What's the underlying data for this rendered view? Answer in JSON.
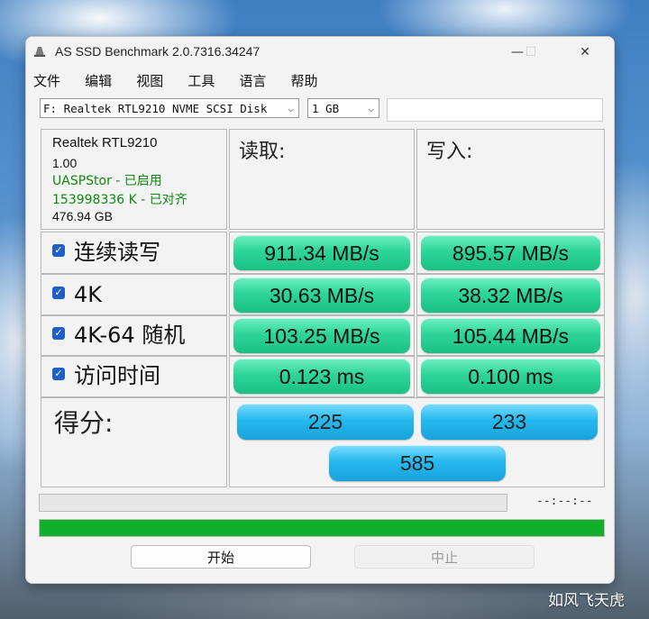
{
  "window": {
    "title": "AS SSD Benchmark 2.0.7316.34247"
  },
  "menu": [
    "文件",
    "编辑",
    "视图",
    "工具",
    "语言",
    "帮助"
  ],
  "toolbar": {
    "drive": "F: Realtek RTL9210 NVME SCSI Disk",
    "size": "1 GB",
    "extra_field": ""
  },
  "device_info": {
    "name": "Realtek RTL9210",
    "firmware": "1.00",
    "driver": "UASPStor - 已启用",
    "alignment": "153998336 K - 已对齐",
    "capacity": "476.94 GB"
  },
  "headers": {
    "read": "读取:",
    "write": "写入:"
  },
  "rows": [
    {
      "label": "连续读写",
      "read": "911.34 MB/s",
      "write": "895.57 MB/s",
      "checked": true
    },
    {
      "label": "4K",
      "read": "30.63 MB/s",
      "write": "38.32 MB/s",
      "checked": true
    },
    {
      "label": "4K-64 随机",
      "read": "103.25 MB/s",
      "write": "105.44 MB/s",
      "checked": true
    },
    {
      "label": "访问时间",
      "read": "0.123 ms",
      "write": "0.100 ms",
      "checked": true
    }
  ],
  "score": {
    "label": "得分:",
    "read": "225",
    "write": "233",
    "total": "585"
  },
  "progress": {
    "timer": "--:--:--",
    "current_fraction": 0,
    "total_fraction": 1.0
  },
  "buttons": {
    "start": "开始",
    "stop": "中止"
  },
  "watermark": "如风飞天虎",
  "colors": {
    "result_green": "#2ed59a",
    "score_blue": "#25b9ee",
    "progress_green": "#11b02a",
    "driver_ok": "#0d8a0d"
  }
}
